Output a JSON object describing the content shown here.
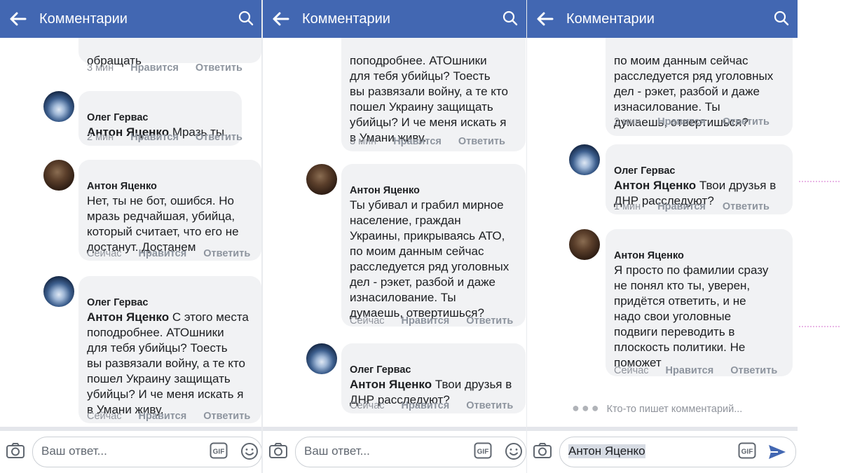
{
  "header": {
    "title": "Комментарии"
  },
  "actions": {
    "like": "Нравится",
    "reply": "Ответить"
  },
  "reply_box": {
    "placeholder": "Ваш ответ...",
    "filled_value": "Антон Яценко",
    "gif": "GIF"
  },
  "colors": {
    "header_bg": "#4267b2",
    "bubble_bg": "#f1f2f4",
    "send_icon": "#4267b2"
  },
  "panel1": {
    "comments": [
      {
        "text": "обращать",
        "time": "3 мин"
      },
      {
        "author": "Олег Гервас",
        "mention": "Антон Яценко",
        "text": " Мразь ты.",
        "time": "2 мин"
      },
      {
        "author": "Антон Яценко",
        "text": "Нет, ты не бот, ошибся. Но\nмразь редчайшая, убийца,\nкоторый считает, что его не\nдостанут. Достанем",
        "time": "Сейчас"
      },
      {
        "author": "Олег Гервас",
        "mention": "Антон Яценко",
        "text": " С этого места\nпоподробнее. АТОшники\nдля тебя убийцы?  Тоесть\nвы развязали войну, а те кто\nпошел Украину защищать\nубийцы?  И че меня искать я\nв Умани живу.",
        "time": "Сейчас"
      }
    ]
  },
  "panel2": {
    "comments": [
      {
        "text": "поподробнее. АТОшники\nдля тебя убийцы?  Тоесть\nвы развязали войну, а те кто\nпошел Украину защищать\nубийцы?  И че меня искать я\nв Умани живу.",
        "time": "3 мин"
      },
      {
        "author": "Антон Яценко",
        "text": "Ты убивал и грабил мирное\nнаселение, граждан\nУкраины, прикрываясь АТО,\nпо моим данным сейчас\nрасследуется ряд уголовных\nдел - рэкет, разбой и даже\nизнасилование. Ты\nдумаешь, отвертишься?",
        "time": "Сейчас"
      },
      {
        "author": "Олег Гервас",
        "mention": "Антон Яценко",
        "text": " Твои друзья в\nДНР расследуют?",
        "time": "Сейчас"
      }
    ]
  },
  "panel3": {
    "comments": [
      {
        "text": "по моим данным сейчас\nрасследуется ряд уголовных\nдел - рэкет, разбой и даже\nизнасилование. Ты\nдумаешь, отвертишься?",
        "time": "2 мин"
      },
      {
        "author": "Олег Гервас",
        "mention": "Антон Яценко",
        "text": " Твои друзья в\nДНР расследуют?",
        "time": "1 мин"
      },
      {
        "author": "Антон Яценко",
        "text": "Я просто по фамилии сразу\nне понял кто ты, уверен,\nпридётся ответить, и не\nнадо свои уголовные\nподвиги переводить в\nплоскость политики. Не\nпоможет",
        "time": "Сейчас"
      }
    ],
    "typing": "Кто-то пишет комментарий..."
  }
}
